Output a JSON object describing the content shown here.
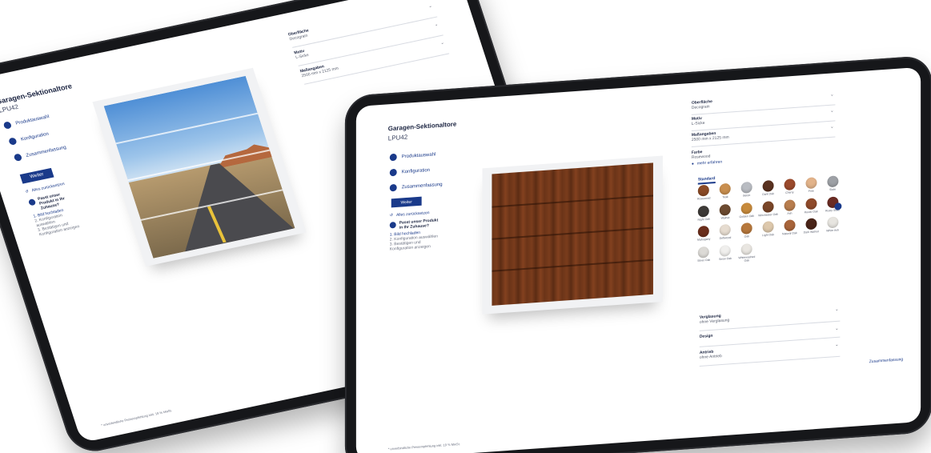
{
  "app": {
    "title": "Garagen-Sektionaltore",
    "subtitle": "LPU42"
  },
  "steps": [
    {
      "label": "Produktauswahl"
    },
    {
      "label": "Konfiguration"
    },
    {
      "label": "Zusammenfassung"
    }
  ],
  "actions": {
    "next_label": "Weiter",
    "reset_label": "Alles zurücksetzen",
    "summary_label": "Zusammenfassung"
  },
  "faq": {
    "question": "Passt unser Produkt in Ihr Zuhause?",
    "links": [
      "1. Bild hochladen",
      "2. Konfiguration auswählen",
      "3. Bestätigen und Konfiguration anzeigen"
    ]
  },
  "footnote": "* unverbindliche Preisempfehlung inkl. 19 % MwSt.",
  "fields": {
    "oberflaeche": {
      "label": "Oberfläche",
      "value": "Decograin"
    },
    "motiv": {
      "label": "Motiv",
      "value": "L-Sicke"
    },
    "massangaben": {
      "label": "Maßangaben",
      "value": "2500 mm x 2125 mm"
    },
    "farbe": {
      "label": "Farbe",
      "value": "Rosewood",
      "link": "mehr erfahren"
    },
    "verglasung": {
      "label": "Verglasung",
      "value": "ohne Verglasung"
    },
    "design": {
      "label": "Design",
      "value": ""
    },
    "antrieb": {
      "label": "Antrieb",
      "value": "ohne Antrieb"
    }
  },
  "color_tab": "Standard",
  "swatches": [
    {
      "name": "Rosewood",
      "color": "#8a4a26"
    },
    {
      "name": "Teak",
      "color": "#c98f4f"
    },
    {
      "name": "Beton",
      "color": "#b9bcc2"
    },
    {
      "name": "Dark Oak",
      "color": "#5a3220"
    },
    {
      "name": "Cherry",
      "color": "#9b4a2c"
    },
    {
      "name": "Pine",
      "color": "#e2b38a"
    },
    {
      "name": "Slate",
      "color": "#9ea1a6"
    },
    {
      "name": "Night Oak",
      "color": "#3d3a37"
    },
    {
      "name": "Walnut",
      "color": "#6c4a30"
    },
    {
      "name": "Golden Oak",
      "color": "#c78a3c"
    },
    {
      "name": "Winchester Oak",
      "color": "#7a4628"
    },
    {
      "name": "Ash",
      "color": "#b87d4e"
    },
    {
      "name": "Rustic Oak",
      "color": "#8f4a2a"
    },
    {
      "name": "Rusty Steel",
      "color": "#6a2c24"
    },
    {
      "name": "Mahogany",
      "color": "#6b2e1c"
    },
    {
      "name": "Driftwood",
      "color": "#e6dcd0"
    },
    {
      "name": "Oak",
      "color": "#b7783c"
    },
    {
      "name": "Light Oak",
      "color": "#ddc8ac"
    },
    {
      "name": "Natural Oak",
      "color": "#a8643a"
    },
    {
      "name": "Dark Walnut",
      "color": "#4a2418"
    },
    {
      "name": "White Ash",
      "color": "#e7e5e0"
    },
    {
      "name": "Silver Oak",
      "color": "#dcdad6"
    },
    {
      "name": "Snow Oak",
      "color": "#f0efed"
    },
    {
      "name": "Whitewashed Oak",
      "color": "#e9e6e1"
    }
  ],
  "colors": {
    "accent": "#1a3a8a",
    "bezel": "#16171a",
    "selected_door": "#6b3418"
  }
}
